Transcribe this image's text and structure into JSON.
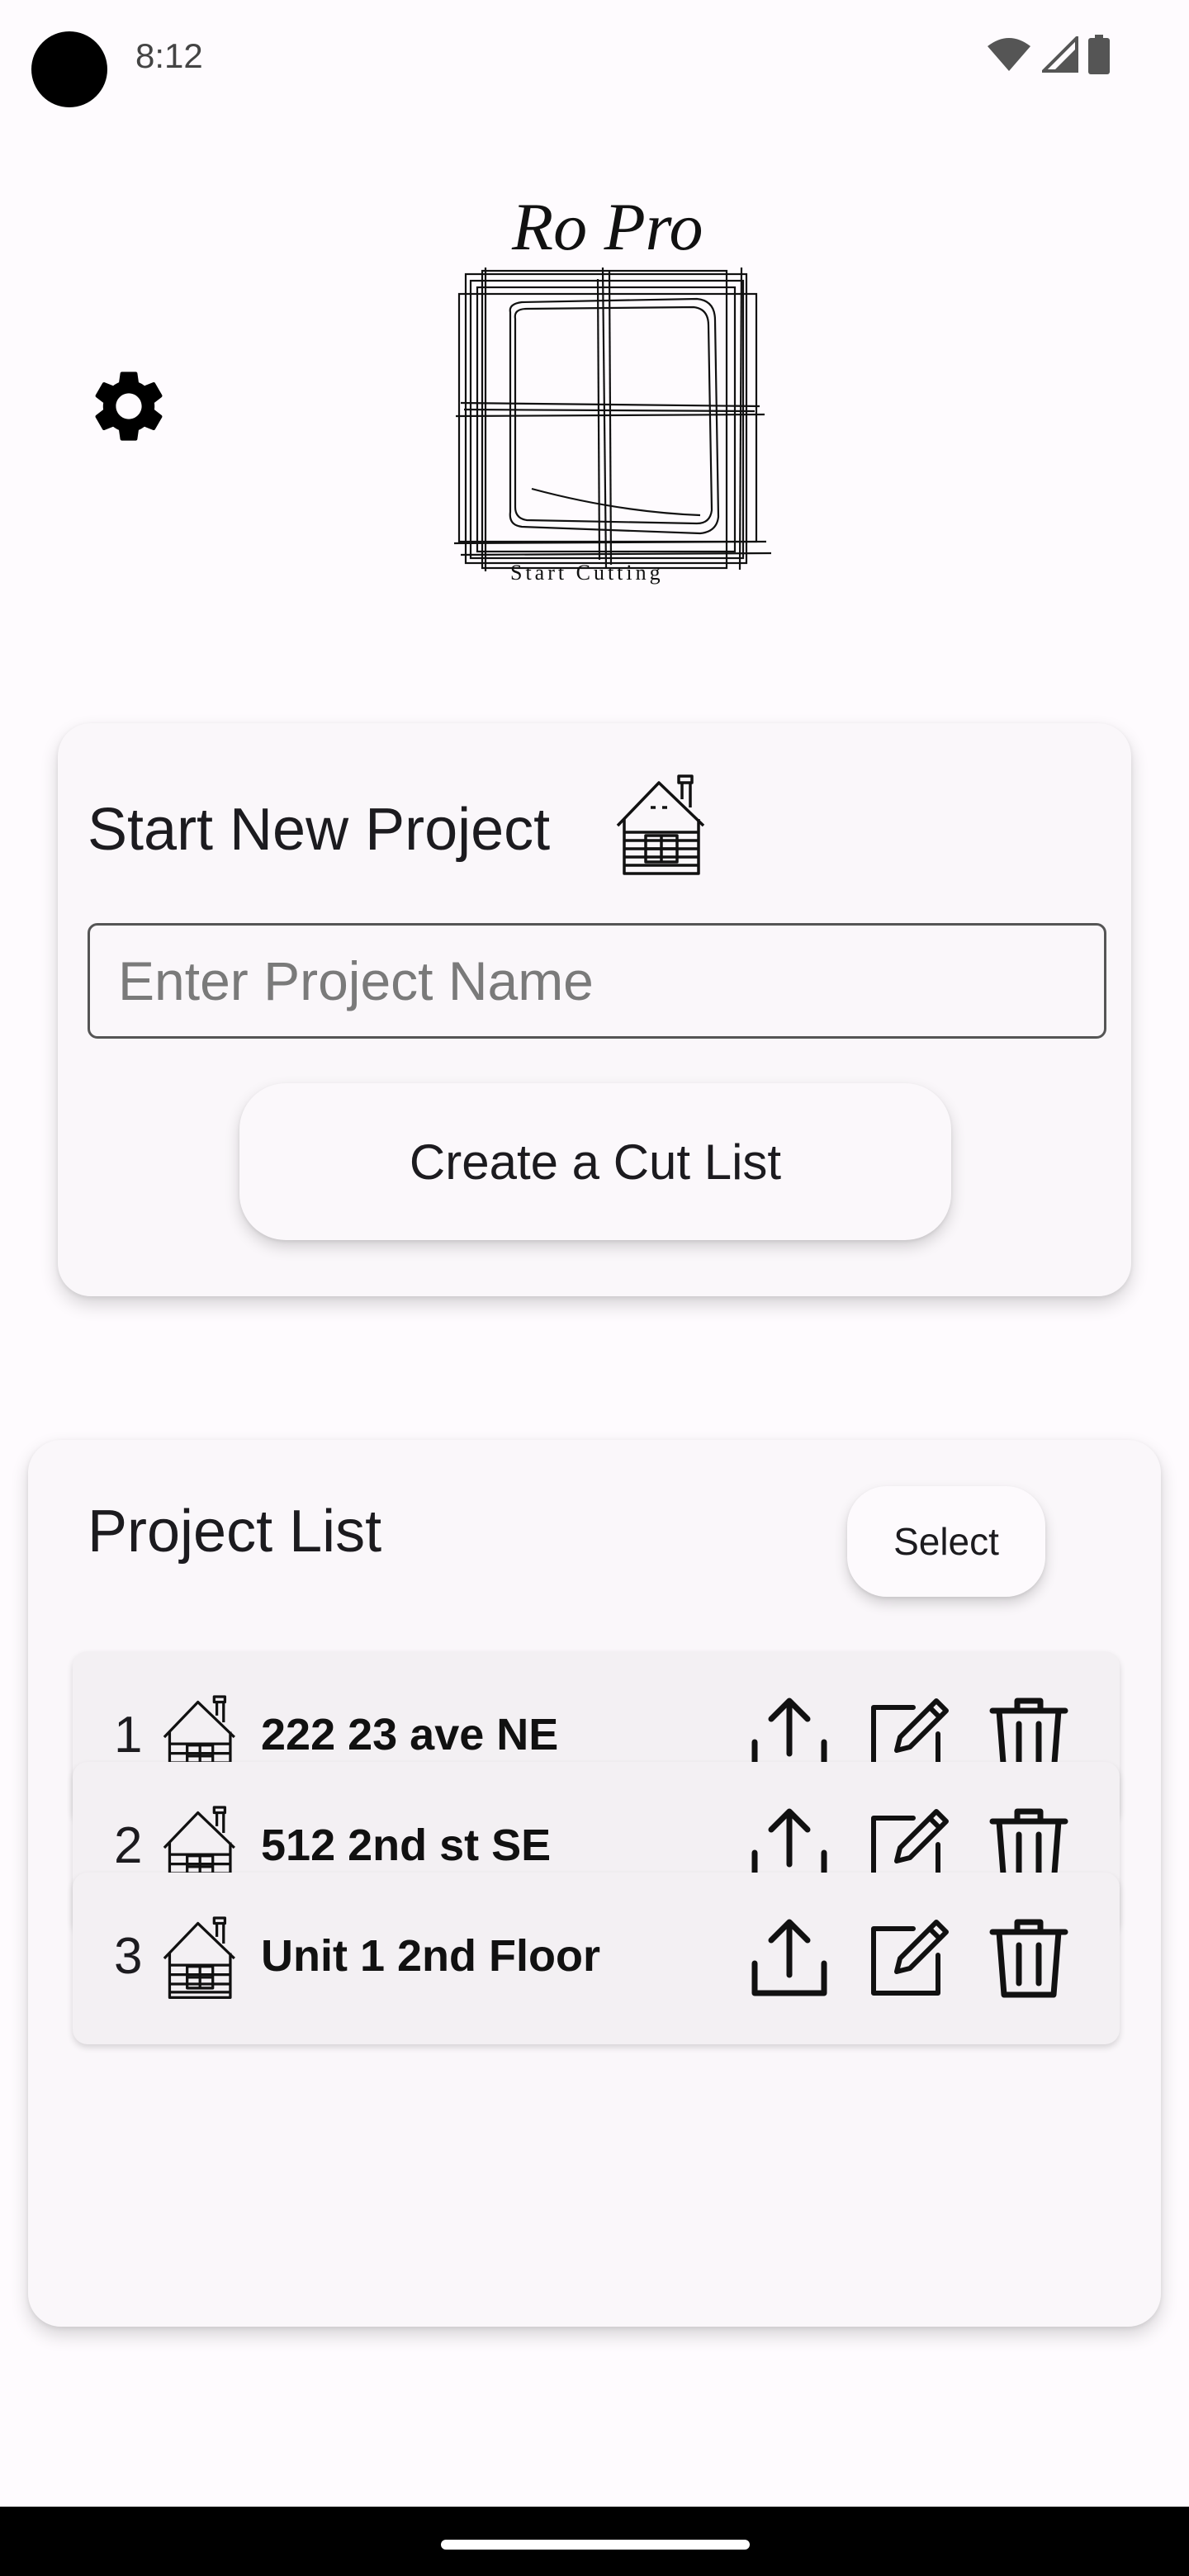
{
  "status_bar": {
    "time": "8:12",
    "icons": [
      "wifi-icon",
      "signal-icon",
      "battery-icon"
    ]
  },
  "header": {
    "settings_icon": "gear-icon",
    "logo": {
      "brand": "Ro Pro",
      "tagline": "Start Cutting"
    }
  },
  "new_project": {
    "title": "Start New Project",
    "icon": "log-cabin-icon",
    "input_placeholder": "Enter Project Name",
    "input_value": "",
    "create_button_label": "Create a Cut List"
  },
  "project_list": {
    "title": "Project List",
    "select_button_label": "Select",
    "columns_actions": [
      "share-icon",
      "edit-icon",
      "delete-icon"
    ],
    "items": [
      {
        "number": "1",
        "name": "222 23 ave NE"
      },
      {
        "number": "2",
        "name": "512 2nd st SE"
      },
      {
        "number": "3",
        "name": "Unit 1 2nd Floor"
      }
    ]
  },
  "colors": {
    "background": "#fefbfe",
    "card": "#faf7fa",
    "row": "#f3f0f3",
    "text": "#1c1b1f"
  }
}
